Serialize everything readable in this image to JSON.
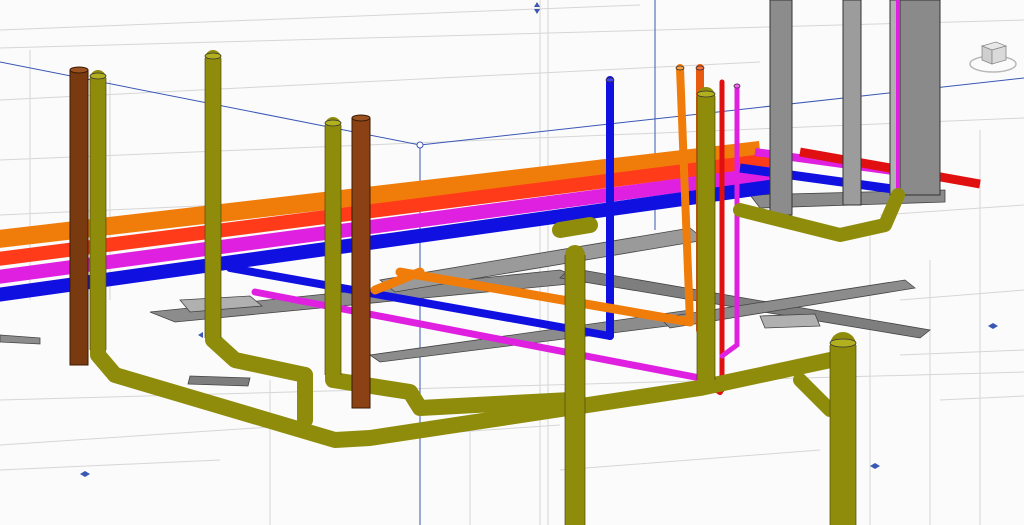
{
  "view": {
    "type": "3D MEP coordination view",
    "background": "#fbfbfb"
  },
  "systems": [
    {
      "name": "sanitary-drain",
      "color": "#8f8c0c"
    },
    {
      "name": "vent",
      "color": "#7a3a10"
    },
    {
      "name": "chilled-water",
      "color": "#1010e0"
    },
    {
      "name": "hot-water",
      "color": "#e01010"
    },
    {
      "name": "heating",
      "color": "#f07d0a"
    },
    {
      "name": "recirculation",
      "color": "#e020e0"
    },
    {
      "name": "cable-tray",
      "color": "#8a8a8a"
    },
    {
      "name": "structural-column",
      "color": "#9a9a9a"
    }
  ],
  "icons": [
    "viewcube-icon",
    "section-box-grip-icon"
  ]
}
